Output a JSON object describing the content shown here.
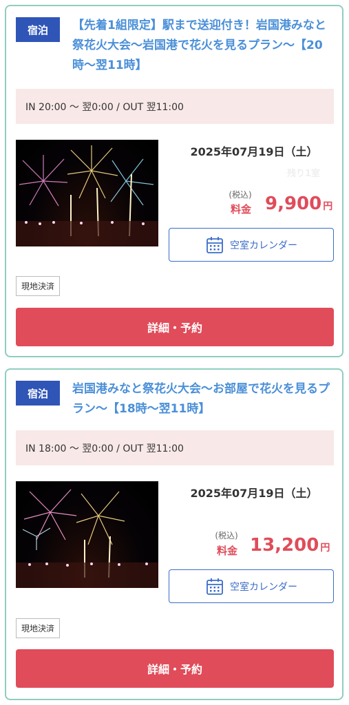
{
  "plans": [
    {
      "badge": "宿泊",
      "title": "【先着1組限定】駅まで送迎付き！岩国港みなと祭花火大会〜岩国港で花火を見るプラン〜【20時〜翌11時】",
      "checkin": "IN 20:00 〜 翌0:00 / OUT 翌11:00",
      "date": "2025年07月19日（土）",
      "remaining": "残り1室",
      "tax_label": "(税込)",
      "price_label": "料金",
      "price": "9,900",
      "currency": "円",
      "calendar_label": "空室カレンダー",
      "payment": "現地決済",
      "reserve_label": "詳細・予約"
    },
    {
      "badge": "宿泊",
      "title": "岩国港みなと祭花火大会〜お部屋で花火を見るプラン〜【18時〜翌11時】",
      "checkin": "IN 18:00 〜 翌0:00 / OUT 翌11:00",
      "date": "2025年07月19日（土）",
      "tax_label": "(税込)",
      "price_label": "料金",
      "price": "13,200",
      "currency": "円",
      "calendar_label": "空室カレンダー",
      "payment": "現地決済",
      "reserve_label": "詳細・予約"
    }
  ],
  "colors": {
    "badge": "#2f55b7",
    "title": "#4a8fd8",
    "price": "#e04c5a",
    "border": "#8fcdbf",
    "checkin_bg": "#f9e8e8",
    "button": "#e04c5a"
  },
  "icons": {
    "calendar": "calendar-icon",
    "photo": "fireworks-photo"
  }
}
